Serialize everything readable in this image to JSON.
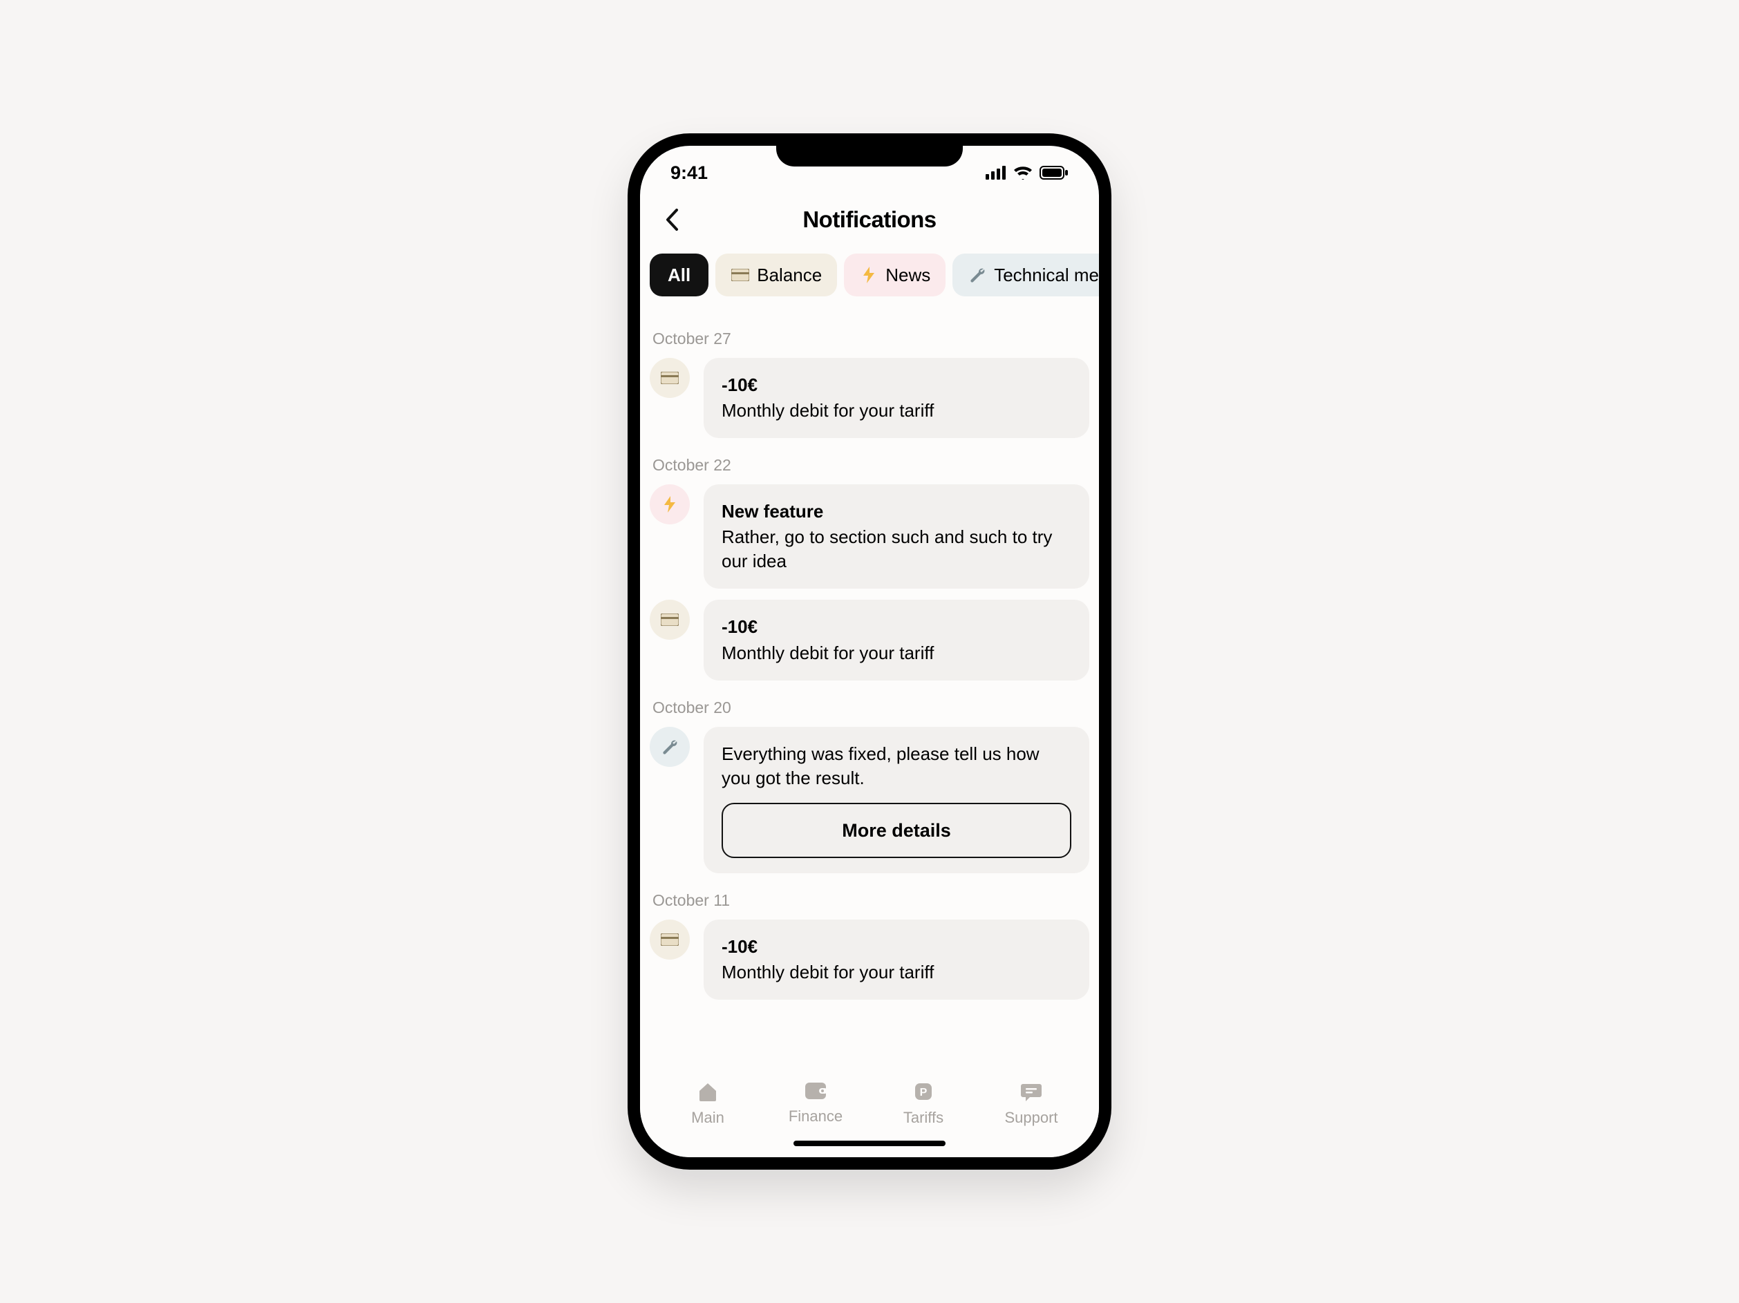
{
  "status": {
    "time": "9:41"
  },
  "header": {
    "title": "Notifications"
  },
  "filters": {
    "all": "All",
    "balance": "Balance",
    "news": "News",
    "technical": "Technical mess..."
  },
  "groups": [
    {
      "date": "October 27",
      "items": [
        {
          "type": "balance",
          "title": "-10€",
          "body": "Monthly debit for your tariff"
        }
      ]
    },
    {
      "date": "October 22",
      "items": [
        {
          "type": "news",
          "title": "New feature",
          "body": "Rather, go to section such and such to try our idea"
        },
        {
          "type": "balance",
          "title": "-10€",
          "body": "Monthly debit for your tariff"
        }
      ]
    },
    {
      "date": "October 20",
      "items": [
        {
          "type": "technical",
          "body": "Everything was fixed, please tell us how you got the result.",
          "action": "More details"
        }
      ]
    },
    {
      "date": "October 11",
      "items": [
        {
          "type": "balance",
          "title": "-10€",
          "body": "Monthly debit for your tariff"
        }
      ]
    }
  ],
  "tabs": {
    "main": "Main",
    "finance": "Finance",
    "tariffs": "Tariffs",
    "support": "Support"
  }
}
